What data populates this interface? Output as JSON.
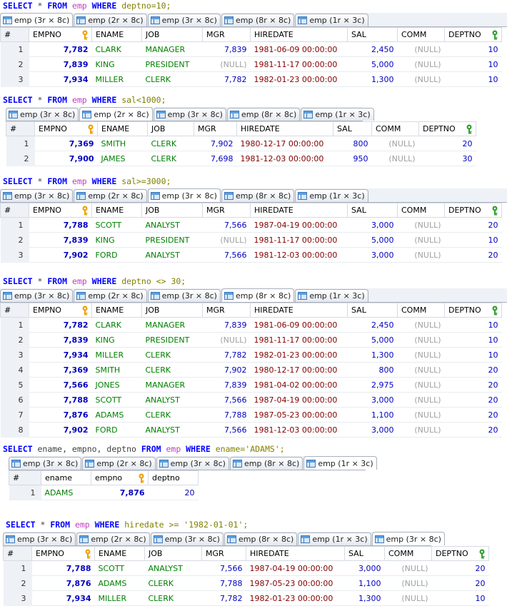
{
  "colors": {
    "keyword": "#0000ff",
    "identifier": "#c040c0",
    "string": "#808000",
    "pk": "#0000c0",
    "text": "#008000",
    "date": "#800000",
    "null": "#a0a0a0",
    "key_gold": "#f0a000",
    "key_green": "#30a030"
  },
  "blocks": [
    {
      "sql": [
        [
          "kw",
          "SELECT "
        ],
        [
          "op",
          "* "
        ],
        [
          "kw",
          "FROM "
        ],
        [
          "id",
          "emp "
        ],
        [
          "kw",
          "WHERE "
        ],
        [
          "txt",
          "deptno=10;"
        ]
      ],
      "tabs": [
        "emp (3r × 8c)",
        "emp (2r × 8c)",
        "emp (3r × 8c)",
        "emp (8r × 8c)",
        "emp (1r × 3c)"
      ],
      "active_tab": 0,
      "columns": [
        "EMPNO",
        "ENAME",
        "JOB",
        "MGR",
        "HIREDATE",
        "SAL",
        "COMM",
        "DEPTNO"
      ],
      "rows": [
        [
          "1",
          "7,782",
          "CLARK",
          "MANAGER",
          "7,839",
          "1981-06-09 00:00:00",
          "2,450",
          "(NULL)",
          "10"
        ],
        [
          "2",
          "7,839",
          "KING",
          "PRESIDENT",
          "(NULL)",
          "1981-11-17 00:00:00",
          "5,000",
          "(NULL)",
          "10"
        ],
        [
          "3",
          "7,934",
          "MILLER",
          "CLERK",
          "7,782",
          "1982-01-23 00:00:00",
          "1,300",
          "(NULL)",
          "10"
        ]
      ]
    },
    {
      "sql": [
        [
          "kw",
          "SELECT "
        ],
        [
          "op",
          "* "
        ],
        [
          "kw",
          "FROM "
        ],
        [
          "id",
          "emp "
        ],
        [
          "kw",
          "WHERE "
        ],
        [
          "txt",
          "sal<1000;"
        ]
      ],
      "tabs": [
        "emp (3r × 8c)",
        "emp (2r × 8c)",
        "emp (3r × 8c)",
        "emp (8r × 8c)",
        "emp (1r × 3c)"
      ],
      "active_tab": 1,
      "columns": [
        "EMPNO",
        "ENAME",
        "JOB",
        "MGR",
        "HIREDATE",
        "SAL",
        "COMM",
        "DEPTNO"
      ],
      "rows": [
        [
          "1",
          "7,369",
          "SMITH",
          "CLERK",
          "7,902",
          "1980-12-17 00:00:00",
          "800",
          "(NULL)",
          "20"
        ],
        [
          "2",
          "7,900",
          "JAMES",
          "CLERK",
          "7,698",
          "1981-12-03 00:00:00",
          "950",
          "(NULL)",
          "30"
        ]
      ]
    },
    {
      "sql": [
        [
          "kw",
          "SELECT "
        ],
        [
          "op",
          "* "
        ],
        [
          "kw",
          "FROM "
        ],
        [
          "id",
          "emp "
        ],
        [
          "kw",
          "WHERE "
        ],
        [
          "txt",
          "sal>=3000;"
        ]
      ],
      "tabs": [
        "emp (3r × 8c)",
        "emp (2r × 8c)",
        "emp (3r × 8c)",
        "emp (8r × 8c)",
        "emp (1r × 3c)"
      ],
      "active_tab": 2,
      "columns": [
        "EMPNO",
        "ENAME",
        "JOB",
        "MGR",
        "HIREDATE",
        "SAL",
        "COMM",
        "DEPTNO"
      ],
      "rows": [
        [
          "1",
          "7,788",
          "SCOTT",
          "ANALYST",
          "7,566",
          "1987-04-19 00:00:00",
          "3,000",
          "(NULL)",
          "20"
        ],
        [
          "2",
          "7,839",
          "KING",
          "PRESIDENT",
          "(NULL)",
          "1981-11-17 00:00:00",
          "5,000",
          "(NULL)",
          "10"
        ],
        [
          "3",
          "7,902",
          "FORD",
          "ANALYST",
          "7,566",
          "1981-12-03 00:00:00",
          "3,000",
          "(NULL)",
          "20"
        ]
      ]
    },
    {
      "sql": [
        [
          "kw",
          "SELECT "
        ],
        [
          "op",
          "* "
        ],
        [
          "kw",
          "FROM "
        ],
        [
          "id",
          "emp "
        ],
        [
          "kw",
          "WHERE "
        ],
        [
          "txt",
          "deptno <> 30;"
        ]
      ],
      "tabs": [
        "emp (3r × 8c)",
        "emp (2r × 8c)",
        "emp (3r × 8c)",
        "emp (8r × 8c)",
        "emp (1r × 3c)"
      ],
      "active_tab": 3,
      "columns": [
        "EMPNO",
        "ENAME",
        "JOB",
        "MGR",
        "HIREDATE",
        "SAL",
        "COMM",
        "DEPTNO"
      ],
      "rows": [
        [
          "1",
          "7,782",
          "CLARK",
          "MANAGER",
          "7,839",
          "1981-06-09 00:00:00",
          "2,450",
          "(NULL)",
          "10"
        ],
        [
          "2",
          "7,839",
          "KING",
          "PRESIDENT",
          "(NULL)",
          "1981-11-17 00:00:00",
          "5,000",
          "(NULL)",
          "10"
        ],
        [
          "3",
          "7,934",
          "MILLER",
          "CLERK",
          "7,782",
          "1982-01-23 00:00:00",
          "1,300",
          "(NULL)",
          "10"
        ],
        [
          "4",
          "7,369",
          "SMITH",
          "CLERK",
          "7,902",
          "1980-12-17 00:00:00",
          "800",
          "(NULL)",
          "20"
        ],
        [
          "5",
          "7,566",
          "JONES",
          "MANAGER",
          "7,839",
          "1981-04-02 00:00:00",
          "2,975",
          "(NULL)",
          "20"
        ],
        [
          "6",
          "7,788",
          "SCOTT",
          "ANALYST",
          "7,566",
          "1987-04-19 00:00:00",
          "3,000",
          "(NULL)",
          "20"
        ],
        [
          "7",
          "7,876",
          "ADAMS",
          "CLERK",
          "7,788",
          "1987-05-23 00:00:00",
          "1,100",
          "(NULL)",
          "20"
        ],
        [
          "8",
          "7,902",
          "FORD",
          "ANALYST",
          "7,566",
          "1981-12-03 00:00:00",
          "3,000",
          "(NULL)",
          "20"
        ]
      ]
    },
    {
      "sql": [
        [
          "kw",
          "SELECT "
        ],
        [
          "op",
          "ename, empno, deptno "
        ],
        [
          "kw",
          "FROM "
        ],
        [
          "id",
          "emp "
        ],
        [
          "kw",
          "WHERE "
        ],
        [
          "txt",
          "ename='ADAMS';"
        ]
      ],
      "tabs": [
        "emp (3r × 8c)",
        "emp (2r × 8c)",
        "emp (3r × 8c)",
        "emp (8r × 8c)",
        "emp (1r × 3c)"
      ],
      "active_tab": 4,
      "columns": [
        "ename",
        "empno",
        "deptno"
      ],
      "rows": [
        [
          "1",
          "ADAMS",
          "7,876",
          "20"
        ]
      ]
    },
    {
      "sql": [
        [
          "kw",
          "SELECT "
        ],
        [
          "op",
          "* "
        ],
        [
          "kw",
          "FROM "
        ],
        [
          "id",
          "emp "
        ],
        [
          "kw",
          "WHERE "
        ],
        [
          "txt",
          "hiredate >= '1982-01-01';"
        ]
      ],
      "tabs": [
        "emp (3r × 8c)",
        "emp (2r × 8c)",
        "emp (3r × 8c)",
        "emp (8r × 8c)",
        "emp (1r × 3c)",
        "emp (3r × 8c)"
      ],
      "active_tab": 5,
      "columns": [
        "EMPNO",
        "ENAME",
        "JOB",
        "MGR",
        "HIREDATE",
        "SAL",
        "COMM",
        "DEPTNO"
      ],
      "rows": [
        [
          "1",
          "7,788",
          "SCOTT",
          "ANALYST",
          "7,566",
          "1987-04-19 00:00:00",
          "3,000",
          "(NULL)",
          "20"
        ],
        [
          "2",
          "7,876",
          "ADAMS",
          "CLERK",
          "7,788",
          "1987-05-23 00:00:00",
          "1,100",
          "(NULL)",
          "20"
        ],
        [
          "3",
          "7,934",
          "MILLER",
          "CLERK",
          "7,782",
          "1982-01-23 00:00:00",
          "1,300",
          "(NULL)",
          "10"
        ]
      ]
    }
  ]
}
